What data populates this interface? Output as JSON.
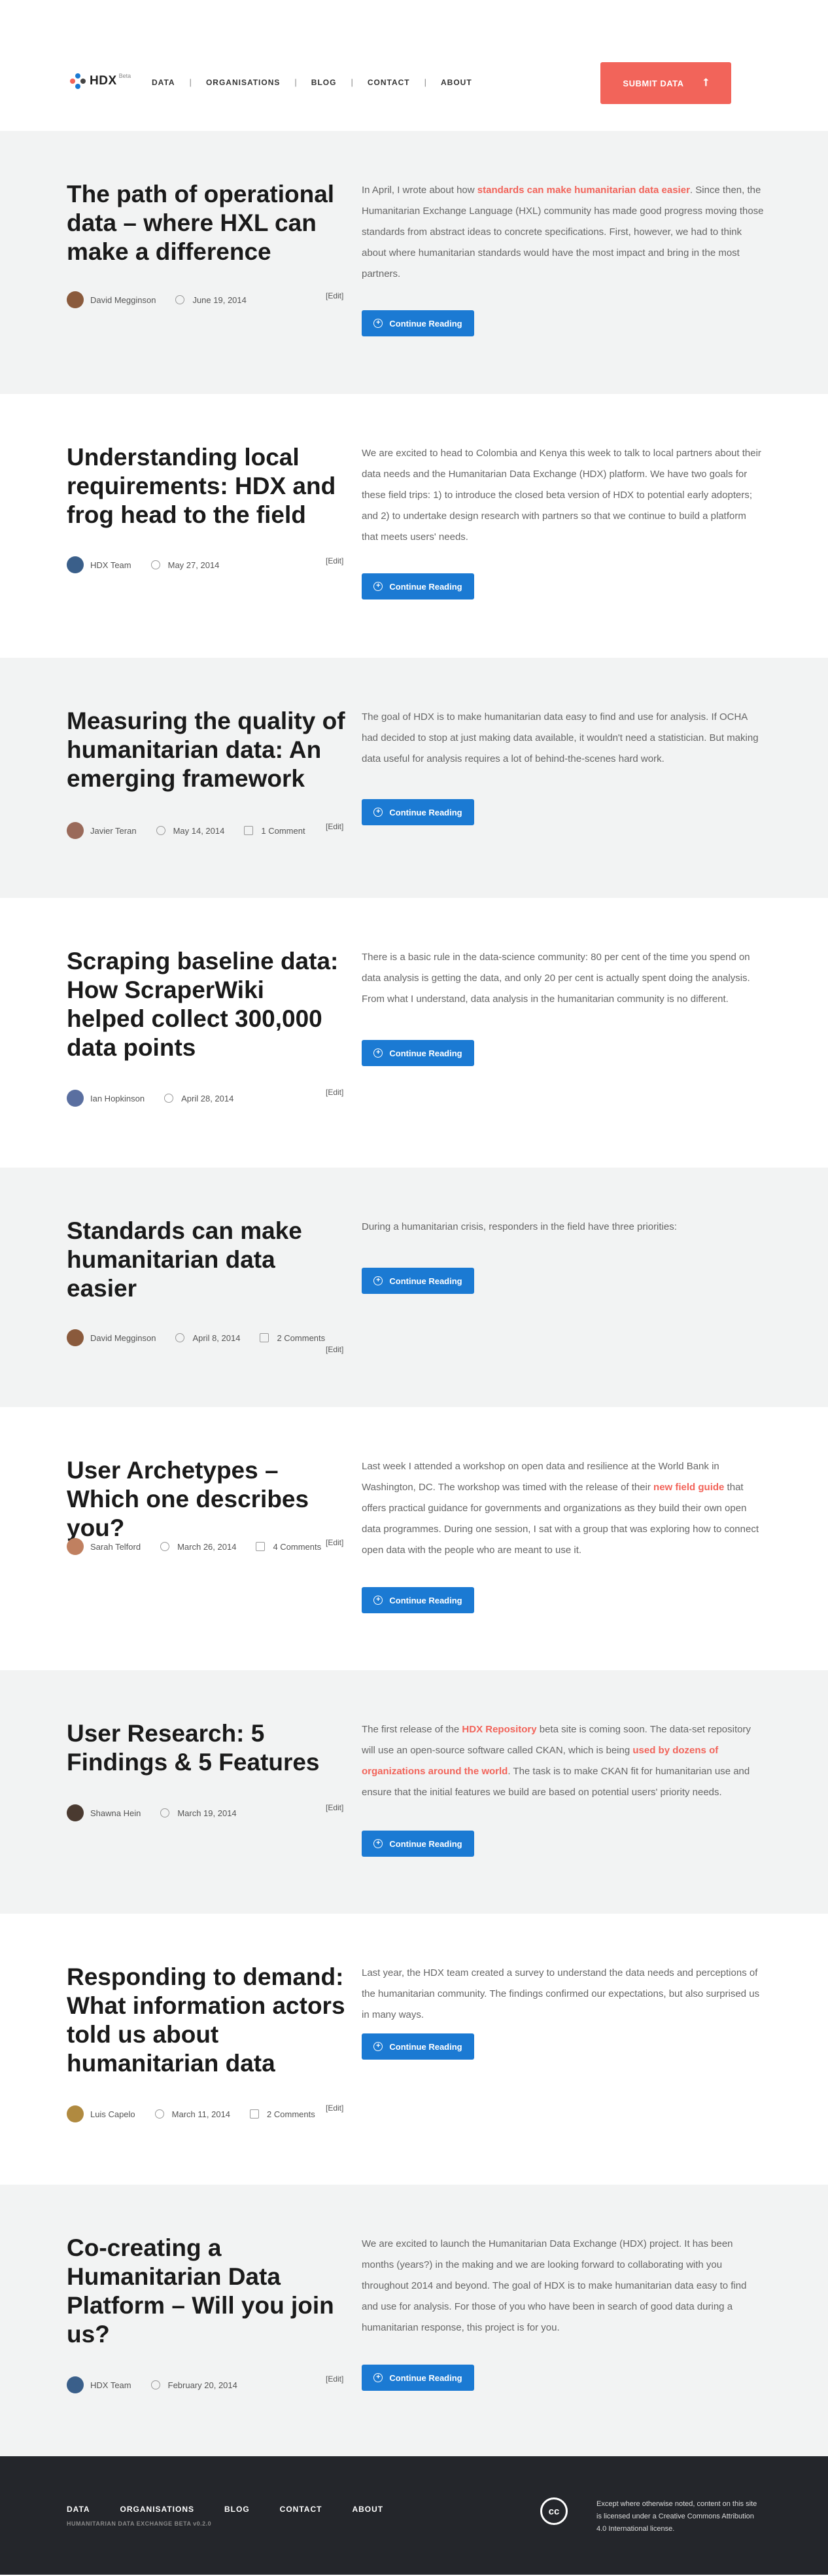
{
  "header": {
    "logo_text": "HDX",
    "logo_sup": "Beta",
    "nav": [
      "DATA",
      "ORGANISATIONS",
      "BLOG",
      "CONTACT",
      "ABOUT"
    ],
    "submit_label": "SUBMIT DATA"
  },
  "common": {
    "read_more": "Continue Reading",
    "edit": "[Edit]"
  },
  "posts": [
    {
      "title": "The path of operational data – where HXL can make a difference",
      "author": "David Megginson",
      "date": "June 19, 2014",
      "comments": "",
      "excerpt_before": "In April, I wrote about how ",
      "excerpt_link": "standards can make humanitarian data easier",
      "excerpt_after": ". Since then, the Humanitarian Exchange Language (HXL) community has made good progress moving those standards from abstract ideas to concrete specifications. First, however, we had to think about where humanitarian standards would have the most impact and bring in the most partners.",
      "avatar_color": "#8a5a3c"
    },
    {
      "title": "Understanding local requirements: HDX and frog head to the field",
      "author": "HDX Team",
      "date": "May 27, 2014",
      "comments": "",
      "excerpt_before": "We are excited to head to Colombia and Kenya this week to talk to local partners about their data needs and the Humanitarian Data Exchange (HDX) platform. We have two goals for these field trips: 1) to introduce the closed beta version of HDX to potential early adopters; and 2) to undertake design research with partners so that we continue to build a platform that meets users' needs.",
      "excerpt_link": "",
      "excerpt_after": "",
      "avatar_color": "#3a5f8a"
    },
    {
      "title": "Measuring the quality of humanitarian data: An emerging framework",
      "author": "Javier Teran",
      "date": "May 14, 2014",
      "comments": "1 Comment",
      "excerpt_before": "The goal of HDX is to make humanitarian data easy to find and use for analysis. If OCHA had decided to stop at just making data available, it wouldn't need a statistician. But making data useful for analysis requires a lot of behind-the-scenes hard work.",
      "excerpt_link": "",
      "excerpt_after": "",
      "avatar_color": "#9a6a5a"
    },
    {
      "title": "Scraping baseline data: How ScraperWiki helped collect 300,000 data points",
      "author": "Ian Hopkinson",
      "date": "April 28, 2014",
      "comments": "",
      "excerpt_before": "There is a basic rule in the data-science community: 80 per cent of the time you spend on data analysis is getting the data, and only 20 per cent is actually spent doing the analysis. From what I understand, data analysis in the humanitarian community is no different.",
      "excerpt_link": "",
      "excerpt_after": "",
      "avatar_color": "#5a6fa0"
    },
    {
      "title": "Standards can make humanitarian data easier",
      "author": "David Megginson",
      "date": "April 8, 2014",
      "comments": "2 Comments",
      "excerpt_before": "During a humanitarian crisis, responders in the field have three priorities:",
      "excerpt_link": "",
      "excerpt_after": "",
      "avatar_color": "#8a5a3c"
    },
    {
      "title": "User Archetypes – Which one describes you?",
      "author": "Sarah Telford",
      "date": "March 26, 2014",
      "comments": "4 Comments",
      "excerpt_before": "Last week I attended a workshop on open data and resilience at the World Bank in Washington, DC. The workshop was timed with the release of their ",
      "excerpt_link": "new field guide",
      "excerpt_after": " that offers practical guidance for governments and organizations as they build their own open data programmes. During one session, I sat with a group that was exploring how to connect open data with the people who are meant to use it.",
      "avatar_color": "#c08060"
    },
    {
      "title": "User Research: 5 Findings & 5 Features",
      "author": "Shawna Hein",
      "date": "March 19, 2014",
      "comments": "",
      "excerpt_before": "The first release of the ",
      "excerpt_link": "HDX Repository",
      "excerpt_after": " beta site is coming soon. The data-set repository will use an open-source software called CKAN, which is being ",
      "excerpt_link2": "used by dozens of organizations around the world",
      "excerpt_after2": ". The task is to make CKAN fit for humanitarian use and ensure that the initial features we build are based on potential users' priority needs.",
      "avatar_color": "#4a3a30"
    },
    {
      "title": "Responding to demand: What information actors told us about humanitarian data",
      "author": "Luis Capelo",
      "date": "March 11, 2014",
      "comments": "2 Comments",
      "excerpt_before": "Last year, the HDX team created a survey to understand the data needs and perceptions of the humanitarian community. The findings confirmed our expectations, but also surprised us in many ways.",
      "excerpt_link": "",
      "excerpt_after": "",
      "avatar_color": "#b08a40"
    },
    {
      "title": "Co-creating a Humanitarian Data Platform – Will you join us?",
      "author": "HDX Team",
      "date": "February 20, 2014",
      "comments": "",
      "excerpt_before": "We are excited to launch the Humanitarian Data Exchange (HDX) project. It has been months (years?) in the making and we are looking forward to collaborating with you throughout 2014 and beyond. The goal of HDX is to make humanitarian data easy to find and use for analysis. For those of you who have been in search of good data during a humanitarian response, this project is for you.",
      "excerpt_link": "",
      "excerpt_after": "",
      "avatar_color": "#3a5f8a"
    }
  ],
  "footer": {
    "nav": [
      "DATA",
      "ORGANISATIONS",
      "BLOG",
      "CONTACT",
      "ABOUT"
    ],
    "sub": "HUMANITARIAN DATA EXCHANGE BETA v0.2.0",
    "cc": "cc",
    "license": "Except where otherwise noted, content on this site is licensed under a Creative Commons Attribution 4.0 International license."
  },
  "colors": {
    "accent": "#f2645a",
    "button": "#1b7ad3",
    "gray_bg": "#f2f3f3",
    "footer_bg": "#24262b"
  }
}
